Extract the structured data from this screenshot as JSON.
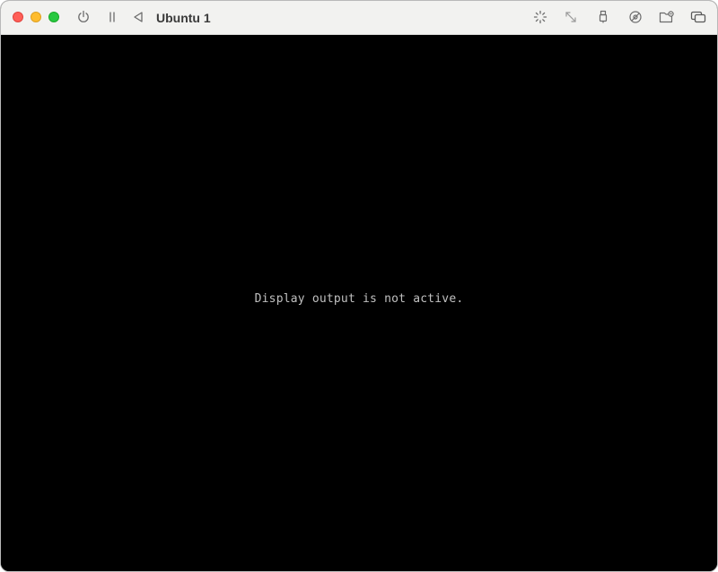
{
  "window": {
    "title": "Ubuntu 1"
  },
  "titlebar": {
    "left_controls": [
      {
        "name": "power-icon"
      },
      {
        "name": "pause-icon"
      },
      {
        "name": "back-icon"
      }
    ],
    "right_controls": [
      {
        "name": "brightness-icon"
      },
      {
        "name": "resize-arrows-icon"
      },
      {
        "name": "usb-icon"
      },
      {
        "name": "network-disc-icon"
      },
      {
        "name": "shared-folder-icon"
      },
      {
        "name": "display-windows-icon"
      }
    ]
  },
  "screen": {
    "message": "Display output is not active.",
    "background": "#000000",
    "text_color": "#c0c0c0"
  },
  "colors": {
    "close": "#ff5f57",
    "minimize": "#febc2e",
    "zoom": "#28c840",
    "titlebar": "#f2f2f0"
  }
}
